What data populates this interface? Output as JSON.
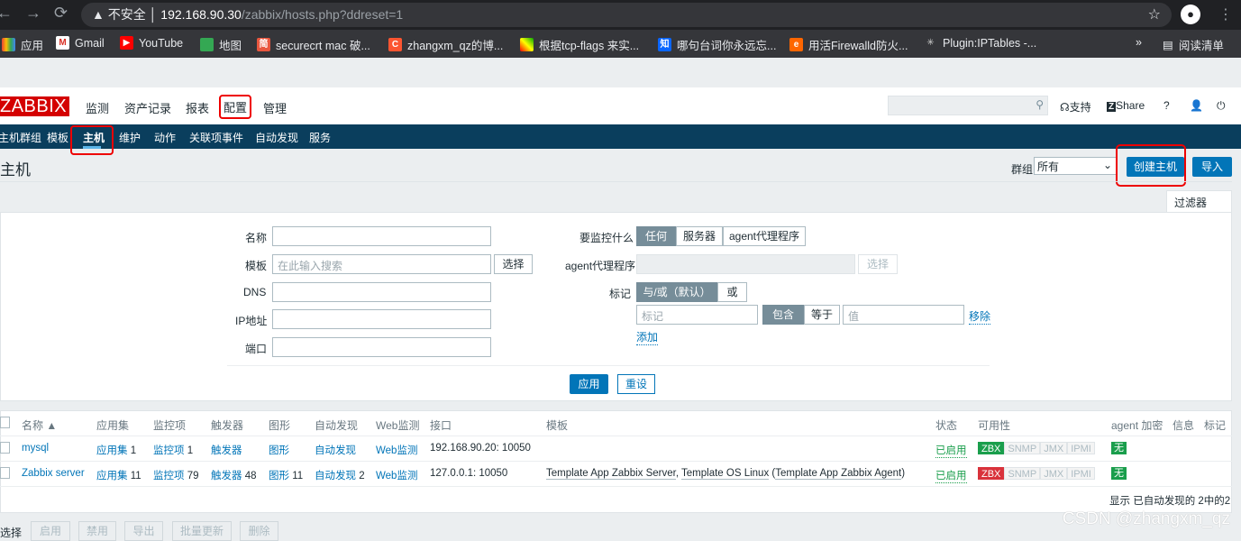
{
  "browser": {
    "back": "←",
    "forward": "→",
    "reload": "⟳",
    "security": "不安全",
    "url_host": "192.168.90.30",
    "url_path": "/zabbix/hosts.php?ddreset=1",
    "bookmarks": [
      {
        "label": "应用",
        "icon": "apps-grid"
      },
      {
        "label": "Gmail",
        "icon": "gmail"
      },
      {
        "label": "YouTube",
        "icon": "youtube"
      },
      {
        "label": "地图",
        "icon": "maps"
      },
      {
        "label": "securecrt mac 破...",
        "icon": "jianshu",
        "glyph": "简"
      },
      {
        "label": "zhangxm_qz的博...",
        "icon": "csdn",
        "glyph": "C"
      },
      {
        "label": "根据tcp-flags 来实...",
        "icon": "image"
      },
      {
        "label": "哪句台词你永远忘...",
        "icon": "zhihu",
        "glyph": "知"
      },
      {
        "label": "用活Firewalld防火...",
        "icon": "e-blog",
        "glyph": "e"
      },
      {
        "label": "Plugin:IPTables -...",
        "icon": "spider"
      }
    ],
    "more": "»",
    "reading_list": "阅读清单"
  },
  "header": {
    "logo": "ZABBIX",
    "menu": [
      "监测",
      "资产记录",
      "报表",
      "配置",
      "管理"
    ],
    "support": "支持",
    "share": "Share",
    "help": "?"
  },
  "submenu": [
    "主机群组",
    "模板",
    "主机",
    "维护",
    "动作",
    "关联项事件",
    "自动发现",
    "服务"
  ],
  "page": {
    "title": "主机",
    "group_label": "群组",
    "group_value": "所有",
    "create_button": "创建主机",
    "import_button": "导入"
  },
  "filter": {
    "tab_label": "过滤器",
    "name_label": "名称",
    "template_label": "模板",
    "template_placeholder": "在此输入搜索",
    "select": "选择",
    "dns_label": "DNS",
    "ip_label": "IP地址",
    "port_label": "端口",
    "monitored_by_label": "要监控什么",
    "monitored_by_options": [
      "任何",
      "服务器",
      "agent代理程序"
    ],
    "proxy_label": "agent代理程序",
    "proxy_select": "选择",
    "tags_label": "标记",
    "tags_ops": [
      "与/或（默认）",
      "或"
    ],
    "tag_placeholder": "标记",
    "tag_ops": [
      "包含",
      "等于"
    ],
    "value_placeholder": "值",
    "remove": "移除",
    "add": "添加",
    "apply": "应用",
    "reset": "重设"
  },
  "table": {
    "headers": [
      "名称 ▲",
      "应用集",
      "监控项",
      "触发器",
      "图形",
      "自动发现",
      "Web监测",
      "接口",
      "模板",
      "状态",
      "可用性",
      "agent 加密",
      "信息",
      "标记"
    ],
    "rows": [
      {
        "name": "mysql",
        "apps": "应用集",
        "apps_n": "1",
        "items": "监控项",
        "items_n": "1",
        "triggers": "触发器",
        "triggers_n": "",
        "graphs": "图形",
        "graphs_n": "",
        "discovery": "自动发现",
        "discovery_n": "",
        "web": "Web监测",
        "interface": "192.168.90.20: 10050",
        "templates": [],
        "status": "已启用",
        "zbx": "ok",
        "encryption": "无"
      },
      {
        "name": "Zabbix server",
        "apps": "应用集",
        "apps_n": "11",
        "items": "监控项",
        "items_n": "79",
        "triggers": "触发器",
        "triggers_n": "48",
        "graphs": "图形",
        "graphs_n": "11",
        "discovery": "自动发现",
        "discovery_n": "2",
        "web": "Web监测",
        "interface": "127.0.0.1: 10050",
        "templates": [
          "Template App Zabbix Server",
          "Template OS Linux",
          "Template App Zabbix Agent"
        ],
        "status": "已启用",
        "zbx": "error",
        "encryption": "无"
      }
    ],
    "availability": [
      "ZBX",
      "SNMP",
      "JMX",
      "IPMI"
    ],
    "summary": "显示 已自动发现的 2中的2"
  },
  "actions": {
    "select_label": "选择",
    "buttons": [
      "启用",
      "禁用",
      "导出",
      "批量更新",
      "删除"
    ]
  },
  "watermark": "CSDN @zhangxm_qz"
}
